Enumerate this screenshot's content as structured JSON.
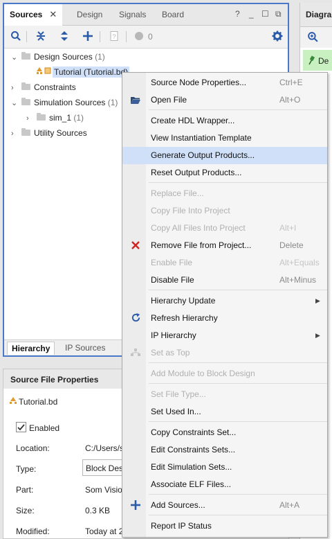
{
  "sources": {
    "tabs": [
      {
        "label": "Sources"
      },
      {
        "label": "Design"
      },
      {
        "label": "Signals"
      },
      {
        "label": "Board"
      }
    ],
    "close_glyph": "✕",
    "win_controls": [
      "?",
      "_",
      "☐",
      "⧉"
    ],
    "toolbar_count": "0",
    "tree": [
      {
        "label": "Design Sources",
        "count": "(1)"
      },
      {
        "label": "Tutorial (Tutorial.bd)"
      },
      {
        "label": "Constraints"
      },
      {
        "label": "Simulation Sources",
        "count": "(1)"
      },
      {
        "label": "sim_1",
        "count": "(1)"
      },
      {
        "label": "Utility Sources"
      }
    ],
    "bottom_tabs": [
      {
        "label": "Hierarchy"
      },
      {
        "label": "IP Sources"
      }
    ]
  },
  "properties": {
    "title": "Source File Properties",
    "file": "Tutorial.bd",
    "enabled_label": "Enabled",
    "rows": [
      {
        "label": "Location:",
        "value": "C:/Users/s"
      },
      {
        "label": "Type:",
        "value": "Block Des"
      },
      {
        "label": "Part:",
        "value": "Som Visio"
      },
      {
        "label": "Size:",
        "value": "0.3 KB"
      },
      {
        "label": "Modified:",
        "value": "Today at 2"
      }
    ]
  },
  "diagram": {
    "tab_label": "Diagra",
    "design_label": "De"
  },
  "context_menu": {
    "items": [
      {
        "label": "Source Node Properties...",
        "shortcut": "Ctrl+E"
      },
      {
        "label": "Open File",
        "shortcut": "Alt+O",
        "icon": "folder-open-icon"
      },
      {
        "label": "Create HDL Wrapper..."
      },
      {
        "label": "View Instantiation Template"
      },
      {
        "label": "Generate Output Products..."
      },
      {
        "label": "Reset Output Products..."
      },
      {
        "label": "Replace File..."
      },
      {
        "label": "Copy File Into Project"
      },
      {
        "label": "Copy All Files Into Project",
        "shortcut": "Alt+I"
      },
      {
        "label": "Remove File from Project...",
        "shortcut": "Delete",
        "icon": "remove-x-icon"
      },
      {
        "label": "Enable File",
        "shortcut": "Alt+Equals"
      },
      {
        "label": "Disable File",
        "shortcut": "Alt+Minus"
      },
      {
        "label": "Hierarchy Update"
      },
      {
        "label": "Refresh Hierarchy",
        "icon": "refresh-icon"
      },
      {
        "label": "IP Hierarchy"
      },
      {
        "label": "Set as Top",
        "icon": "hierarchy-icon"
      },
      {
        "label": "Add Module to Block Design"
      },
      {
        "label": "Set File Type..."
      },
      {
        "label": "Set Used In..."
      },
      {
        "label": "Copy Constraints Set..."
      },
      {
        "label": "Edit Constraints Sets..."
      },
      {
        "label": "Edit Simulation Sets..."
      },
      {
        "label": "Associate ELF Files..."
      },
      {
        "label": "Add Sources...",
        "shortcut": "Alt+A",
        "icon": "plus-icon"
      },
      {
        "label": "Report IP Status"
      }
    ]
  },
  "colors": {
    "accent_blue": "#2a5aa8",
    "selection": "#cfe0f8",
    "remove_red": "#d42020",
    "panel_border": "#4a78c8"
  }
}
